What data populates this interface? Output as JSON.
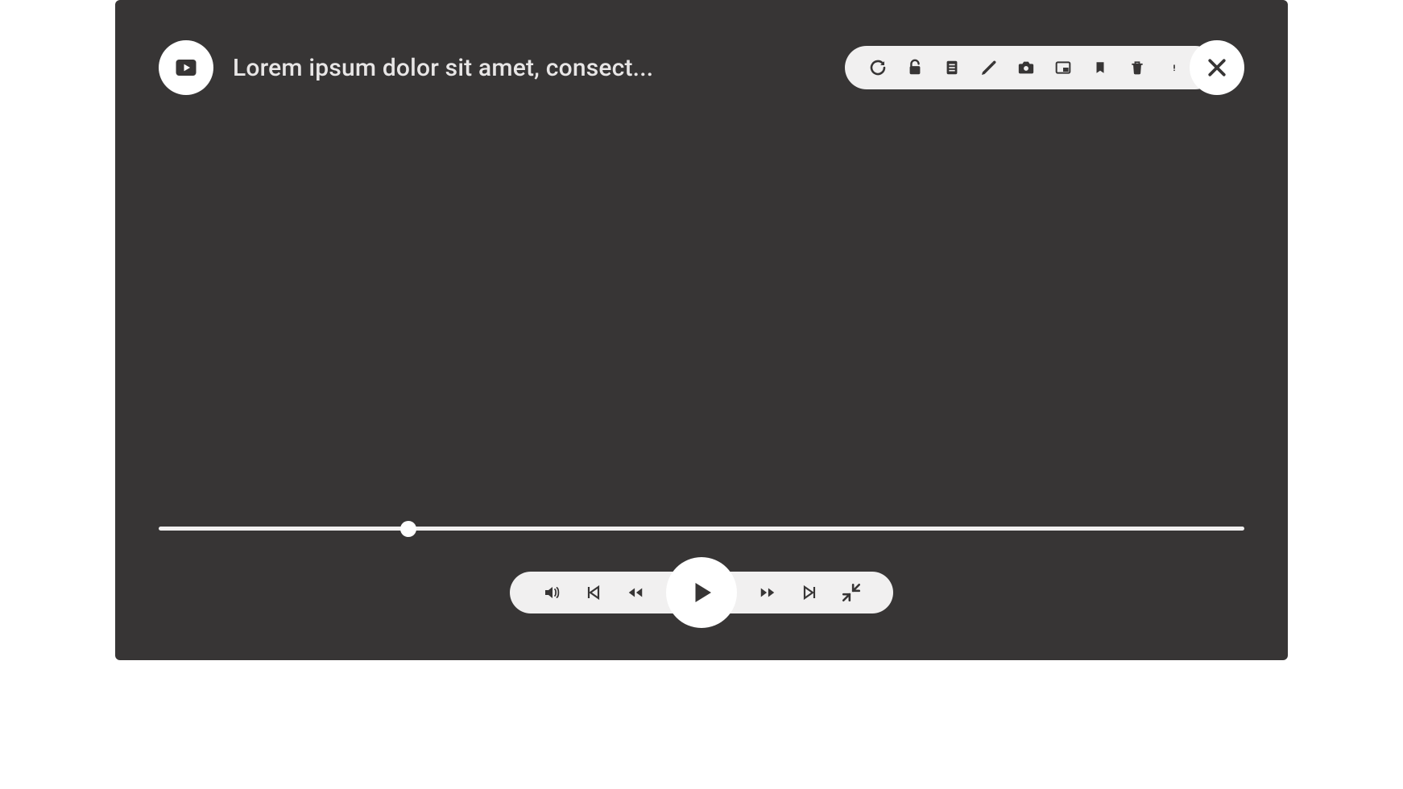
{
  "header": {
    "title": "Lorem ipsum dolor sit amet, consect..."
  },
  "icons": {
    "video": "video-icon",
    "close": "close-icon"
  },
  "toolbar": {
    "items": [
      {
        "name": "refresh-icon"
      },
      {
        "name": "lock-icon"
      },
      {
        "name": "notes-icon"
      },
      {
        "name": "edit-icon"
      },
      {
        "name": "camera-icon"
      },
      {
        "name": "pip-icon"
      },
      {
        "name": "bookmark-icon"
      },
      {
        "name": "delete-icon"
      },
      {
        "name": "info-icon"
      }
    ]
  },
  "progress": {
    "percent": 23
  },
  "playback": {
    "items_left": [
      {
        "name": "volume-icon"
      },
      {
        "name": "skip-previous-icon"
      },
      {
        "name": "rewind-icon"
      }
    ],
    "center": {
      "name": "play-icon"
    },
    "items_right": [
      {
        "name": "fast-forward-icon"
      },
      {
        "name": "skip-next-icon"
      },
      {
        "name": "collapse-icon"
      }
    ]
  },
  "colors": {
    "bg": "#373535",
    "pill": "#f1f0f0",
    "white": "#ffffff",
    "text": "#e8e6e6",
    "icon": "#373535"
  }
}
